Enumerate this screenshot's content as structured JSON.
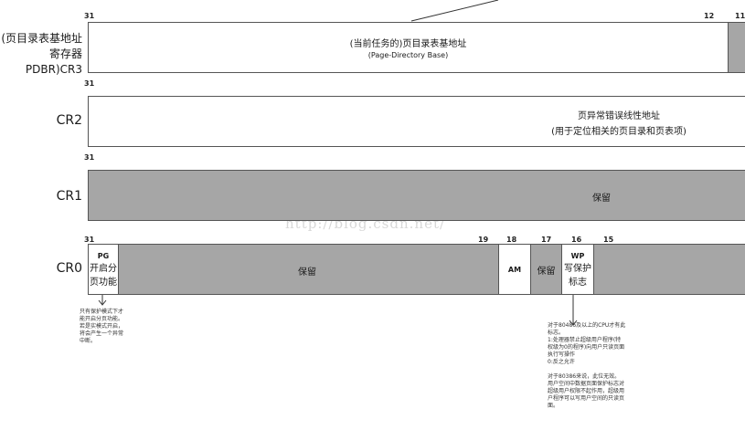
{
  "watermark": "http://blog.csdn.net/",
  "cr3": {
    "side_label_line1": "(页目录表基地址",
    "side_label_line2": "寄存器PDBR)CR3",
    "bit_left": "31",
    "bit_mid": "12",
    "bit_right": "11",
    "field_title": "(当前任务的)页目录表基地址",
    "field_sub": "(Page-Directory Base)"
  },
  "cr2": {
    "label": "CR2",
    "bit_left": "31",
    "field_line1": "页异常错误线性地址",
    "field_line2": "(用于定位相关的页目录和页表项)"
  },
  "cr1": {
    "label": "CR1",
    "bit_left": "31",
    "field": "保留"
  },
  "cr0": {
    "label": "CR0",
    "bits": {
      "b31": "31",
      "b19": "19",
      "b18": "18",
      "b17": "17",
      "b16": "16",
      "b15": "15"
    },
    "pg_title": "PG",
    "pg_line1": "开启分",
    "pg_line2": "页功能",
    "reserved_main": "保留",
    "am": "AM",
    "reserved_17": "保留",
    "wp_title": "WP",
    "wp_line1": "写保护",
    "wp_line2": "标志"
  },
  "notes": {
    "pg_note": "只有保护模式下才\n能开启分页功能。\n若是实模式开启，\n将会产生一个异常\n中断。",
    "wp_note": "对于80486及以上的CPU才有此\n标志。\n1:处理器禁止超级用户程序(特\n权级为0的程序)向用户只读页面\n执行写操作\n0:反之允许\n\n对于80386来说，此位无效。\n用户空间中数据页面保护标志对\n超级用户权限不起作用，超级用\n户程序可以写用户空间的只读页\n面。"
  },
  "colors": {
    "reserved_fill": "#a6a6a6",
    "field_fill": "#ffffff",
    "border": "#555555"
  }
}
